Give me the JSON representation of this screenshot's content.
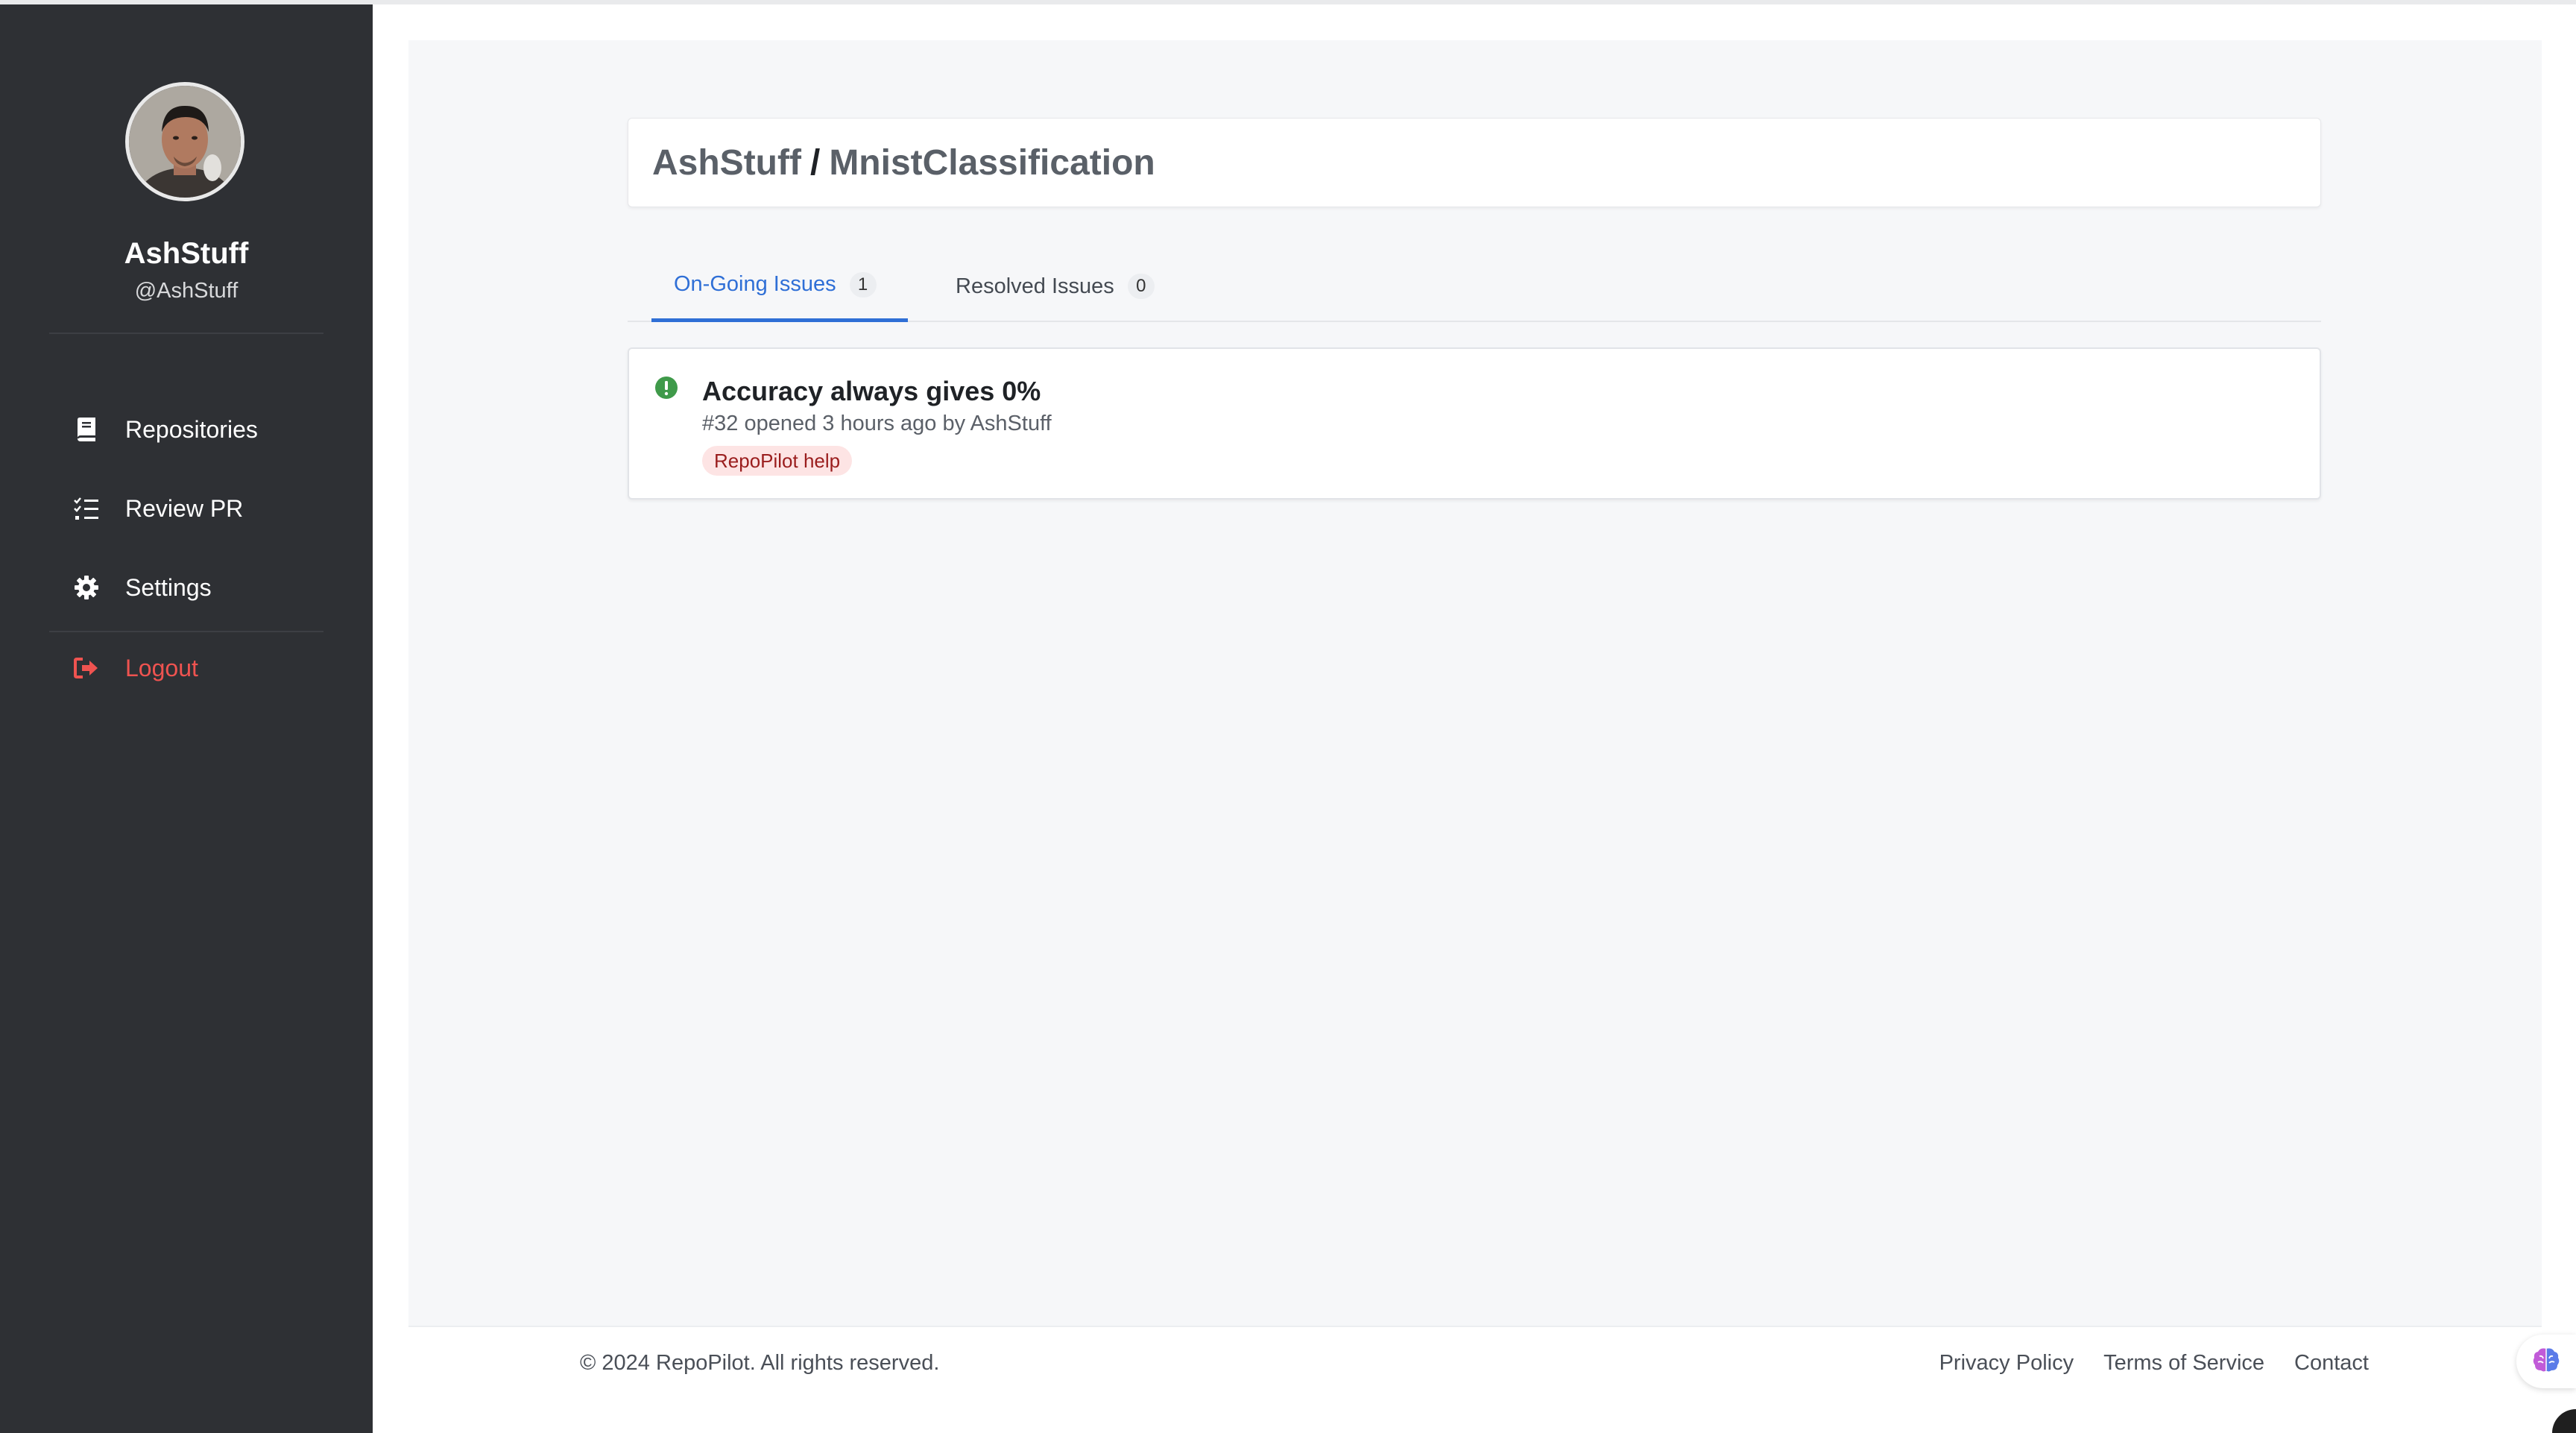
{
  "profile": {
    "name": "AshStuff",
    "handle": "@AshStuff"
  },
  "sidebar": {
    "items": [
      {
        "label": "Repositories",
        "icon": "book-icon"
      },
      {
        "label": "Review PR",
        "icon": "list-check-icon"
      },
      {
        "label": "Settings",
        "icon": "gear-icon"
      }
    ],
    "logout": {
      "label": "Logout",
      "icon": "logout-icon",
      "color": "#ef5350"
    }
  },
  "repo": {
    "owner": "AshStuff",
    "separator": "/",
    "name": "MnistClassification"
  },
  "tabs": [
    {
      "label": "On-Going Issues",
      "count": "1",
      "active": true
    },
    {
      "label": "Resolved Issues",
      "count": "0",
      "active": false
    }
  ],
  "issues": [
    {
      "title": "Accuracy always gives 0%",
      "meta": "#32 opened 3 hours ago by AshStuff",
      "label": "RepoPilot help",
      "status_icon": "open-issue-icon",
      "status_color": "#3f9a4a"
    }
  ],
  "footer": {
    "copyright": "© 2024 RepoPilot. All rights reserved.",
    "links": [
      "Privacy Policy",
      "Terms of Service",
      "Contact"
    ]
  },
  "colors": {
    "sidebar_bg": "#2e3034",
    "accent": "#2f6fd6",
    "label_bg": "#fde4e4",
    "label_text": "#9a1d1d"
  }
}
